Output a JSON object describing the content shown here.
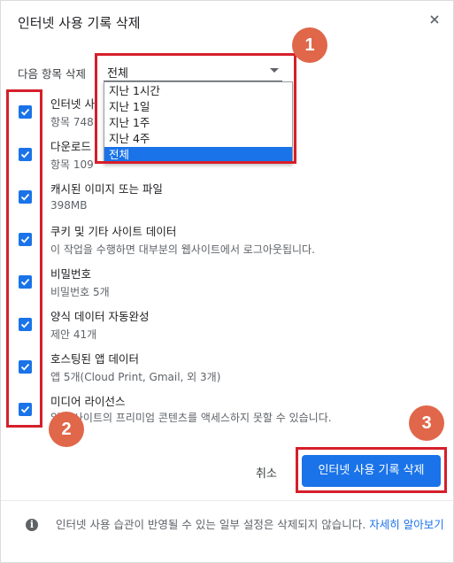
{
  "dialog": {
    "title": "인터넷 사용 기록 삭제",
    "close_icon": "close-icon"
  },
  "time_range": {
    "label": "다음 항목 삭제",
    "value": "전체",
    "options": [
      "지난 1시간",
      "지난 1일",
      "지난 1주",
      "지난 4주",
      "전체"
    ],
    "selected_index": 4
  },
  "items": [
    {
      "title": "인터넷 사",
      "subtitle": "항목 748",
      "checked": true
    },
    {
      "title": "다운로드",
      "subtitle": "항목 109",
      "checked": true
    },
    {
      "title": "캐시된 이미지 또는 파일",
      "subtitle": "398MB",
      "checked": true
    },
    {
      "title": "쿠키 및 기타 사이트 데이터",
      "subtitle": "이 작업을 수행하면 대부분의 웹사이트에서 로그아웃됩니다.",
      "checked": true
    },
    {
      "title": "비밀번호",
      "subtitle": "비밀번호 5개",
      "checked": true
    },
    {
      "title": "양식 데이터 자동완성",
      "subtitle": "제안 41개",
      "checked": true
    },
    {
      "title": "호스팅된 앱 데이터",
      "subtitle": "앱 5개(Cloud Print, Gmail, 외 3개)",
      "checked": true
    },
    {
      "title": "미디어 라이선스",
      "subtitle": "일부 사이트의 프리미엄 콘텐츠를 액세스하지 못할 수 있습니다.",
      "checked": true
    }
  ],
  "buttons": {
    "cancel": "취소",
    "clear": "인터넷 사용 기록 삭제"
  },
  "footer": {
    "text": "인터넷 사용 습관이 반영될 수 있는 일부 설정은 삭제되지 않습니다.",
    "link": "자세히 알아보기"
  },
  "annotations": {
    "badge_1": "1",
    "badge_2": "2",
    "badge_3": "3",
    "highlight_color": "#d61f2b",
    "badge_color": "#e0674a"
  },
  "colors": {
    "accent": "#1a73e8"
  }
}
